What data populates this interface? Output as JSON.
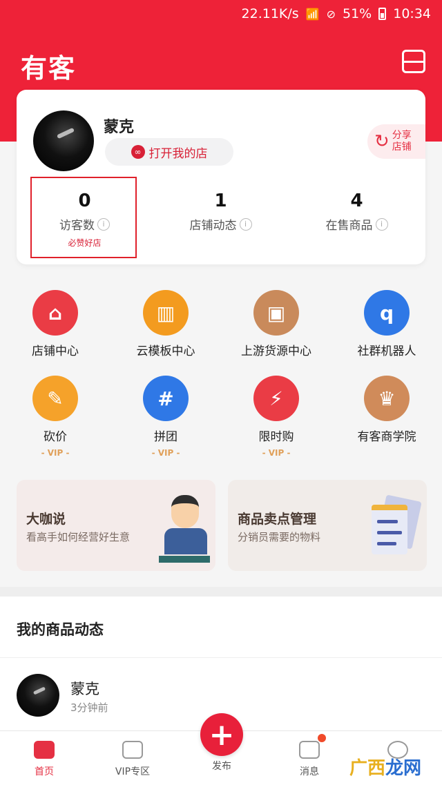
{
  "status_bar": {
    "speed": "22.11K/s",
    "battery": "51%",
    "time": "10:34"
  },
  "app": {
    "logo": "有客"
  },
  "profile": {
    "name": "蒙克",
    "open_shop": "打开我的店",
    "share": "分享店铺"
  },
  "stats": [
    {
      "value": "0",
      "label": "访客数",
      "hint": "必赞好店"
    },
    {
      "value": "1",
      "label": "店铺动态"
    },
    {
      "value": "4",
      "label": "在售商品"
    }
  ],
  "tools": [
    {
      "label": "店铺中心",
      "icon": "store-icon",
      "color": "#ea3c45"
    },
    {
      "label": "云模板中心",
      "icon": "template-icon",
      "color": "#f39b1f"
    },
    {
      "label": "上游货源中心",
      "icon": "box-icon",
      "color": "#c98a5b"
    },
    {
      "label": "社群机器人",
      "icon": "robot-icon",
      "color": "#2f78e6"
    },
    {
      "label": "砍价",
      "icon": "price-tag-icon",
      "color": "#f5a22a",
      "vip": "- VIP -"
    },
    {
      "label": "拼团",
      "icon": "group-buy-icon",
      "color": "#2f78e6",
      "vip": "- VIP -"
    },
    {
      "label": "限时购",
      "icon": "flash-sale-icon",
      "color": "#ea3c45",
      "vip": "- VIP -"
    },
    {
      "label": "有客商学院",
      "icon": "crown-icon",
      "color": "#d08b5a"
    }
  ],
  "promos": [
    {
      "title": "大咖说",
      "subtitle": "看高手如何经营好生意"
    },
    {
      "title": "商品卖点管理",
      "subtitle": "分销员需要的物料"
    }
  ],
  "feed": {
    "title": "我的商品动态",
    "post": {
      "name": "蒙克",
      "time": "3分钟前"
    }
  },
  "tabbar": {
    "home": "首页",
    "vip": "VIP专区",
    "publish": "发布",
    "messages": "消息"
  },
  "watermark": {
    "part1": "广西",
    "part2": "龙网"
  }
}
